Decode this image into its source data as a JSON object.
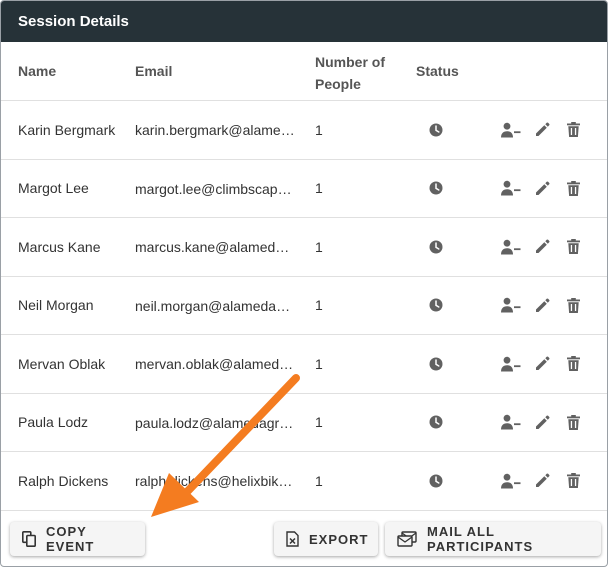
{
  "header": {
    "title": "Session Details"
  },
  "columns": {
    "name": "Name",
    "email": "Email",
    "people_line1": "Number of",
    "people_line2": "People",
    "status": "Status"
  },
  "rows": [
    {
      "name": "Karin Bergmark",
      "email": "karin.bergmark@alame…",
      "people": "1"
    },
    {
      "name": "Margot Lee",
      "email": "margot.lee@climbscap…",
      "people": "1"
    },
    {
      "name": "Marcus Kane",
      "email": "marcus.kane@alameda…",
      "people": "1"
    },
    {
      "name": "Neil Morgan",
      "email": "neil.morgan@alamedag…",
      "people": "1"
    },
    {
      "name": "Mervan Oblak",
      "email": "mervan.oblak@alamed…",
      "people": "1"
    },
    {
      "name": "Paula Lodz",
      "email": "paula.lodz@alamedagr…",
      "people": "1"
    },
    {
      "name": "Ralph Dickens",
      "email": "ralph.dickens@helixbik…",
      "people": "1"
    }
  ],
  "icons": {
    "status": "clock-icon",
    "remove_person": "person-remove-icon",
    "edit": "pencil-icon",
    "delete": "trash-icon"
  },
  "buttons": {
    "copy_event": "COPY EVENT",
    "export": "EXPORT",
    "mail_all": "MAIL ALL PARTICIPANTS"
  },
  "colors": {
    "header_bg": "#263238",
    "icon": "#616161",
    "annotation_arrow": "#f47c20"
  }
}
